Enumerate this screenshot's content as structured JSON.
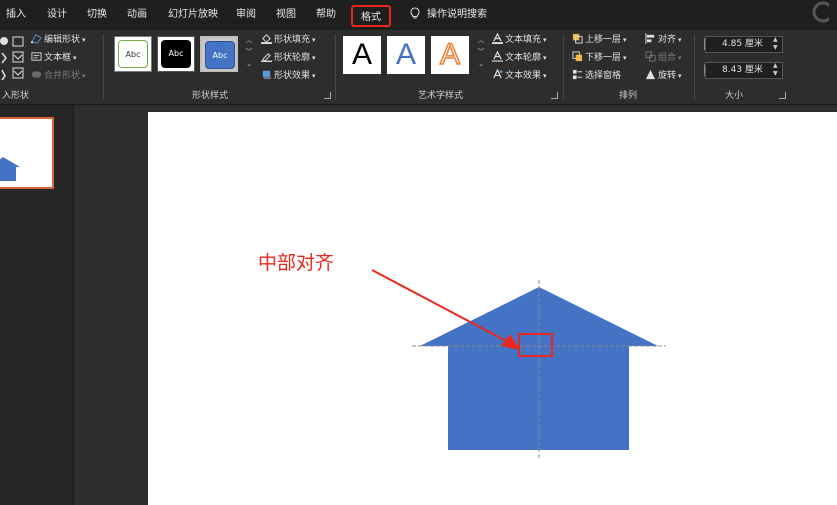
{
  "tabs": [
    "插入",
    "设计",
    "切换",
    "动画",
    "幻灯片放映",
    "审阅",
    "视图",
    "帮助",
    "格式",
    "操作说明搜索"
  ],
  "ribbon": {
    "insert_shapes": {
      "edit_shape": "编辑形状",
      "text_box": "文本框",
      "merge_shapes": "合并形状",
      "label": "入形状"
    },
    "shape_styles": {
      "swatch_text": "Abc",
      "fill": "形状填充",
      "outline": "形状轮廓",
      "effects": "形状效果",
      "label": "形状样式"
    },
    "wordart": {
      "letter": "A",
      "fill": "文本填充",
      "outline": "文本轮廓",
      "effects": "文本效果",
      "label": "艺术字样式"
    },
    "arrange": {
      "bring_forward": "上移一层",
      "send_backward": "下移一层",
      "selection_pane": "选择窗格",
      "align": "对齐",
      "group": "组合",
      "rotate": "旋转",
      "label": "排列"
    },
    "size": {
      "height": "4.85 厘米",
      "width": "8.43 厘米",
      "label": "大小"
    }
  },
  "annotation": "中部对齐",
  "colors": {
    "accent_red": "#e8281c",
    "shape_blue": "#4472c4",
    "ribbon_bg": "#2d2d2d",
    "tabbar_bg": "#1f1f1f"
  }
}
